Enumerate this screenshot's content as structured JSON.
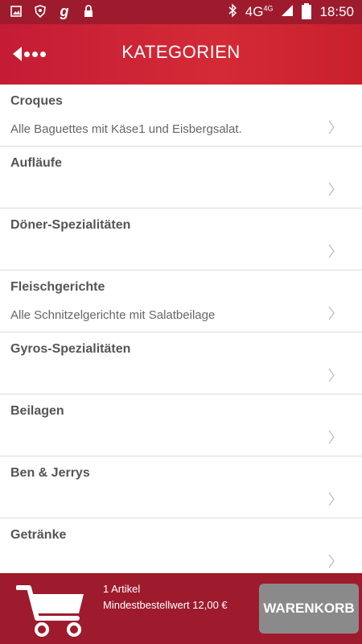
{
  "status_bar": {
    "network": "4G",
    "network_sup": "4G",
    "time": "18:50",
    "icons": [
      "image-icon",
      "shield-icon",
      "g-icon",
      "lock-icon",
      "bluetooth-icon",
      "signal-icon",
      "battery-icon"
    ]
  },
  "header": {
    "title": "KATEGORIEN"
  },
  "categories": [
    {
      "name": "Croques",
      "description": "Alle Baguettes mit Käse1 und Eisbergsalat."
    },
    {
      "name": "Aufläufe",
      "description": ""
    },
    {
      "name": "Döner-Spezialitäten",
      "description": ""
    },
    {
      "name": "Fleischgerichte",
      "description": "Alle Schnitzelgerichte mit Salatbeilage"
    },
    {
      "name": "Gyros-Spezialitäten",
      "description": ""
    },
    {
      "name": "Beilagen",
      "description": ""
    },
    {
      "name": "Ben & Jerrys",
      "description": ""
    },
    {
      "name": "Getränke",
      "description": ""
    }
  ],
  "cart": {
    "count_text": "1 Artikel",
    "minimum_text": "Mindestbestellwert 12,00 €",
    "button_label": "WARENKORB"
  },
  "colors": {
    "status_bar": "#9e1b2e",
    "header": "#c41c35",
    "cart_bar": "#9e1b2e",
    "cart_button": "#8a8a8a"
  }
}
